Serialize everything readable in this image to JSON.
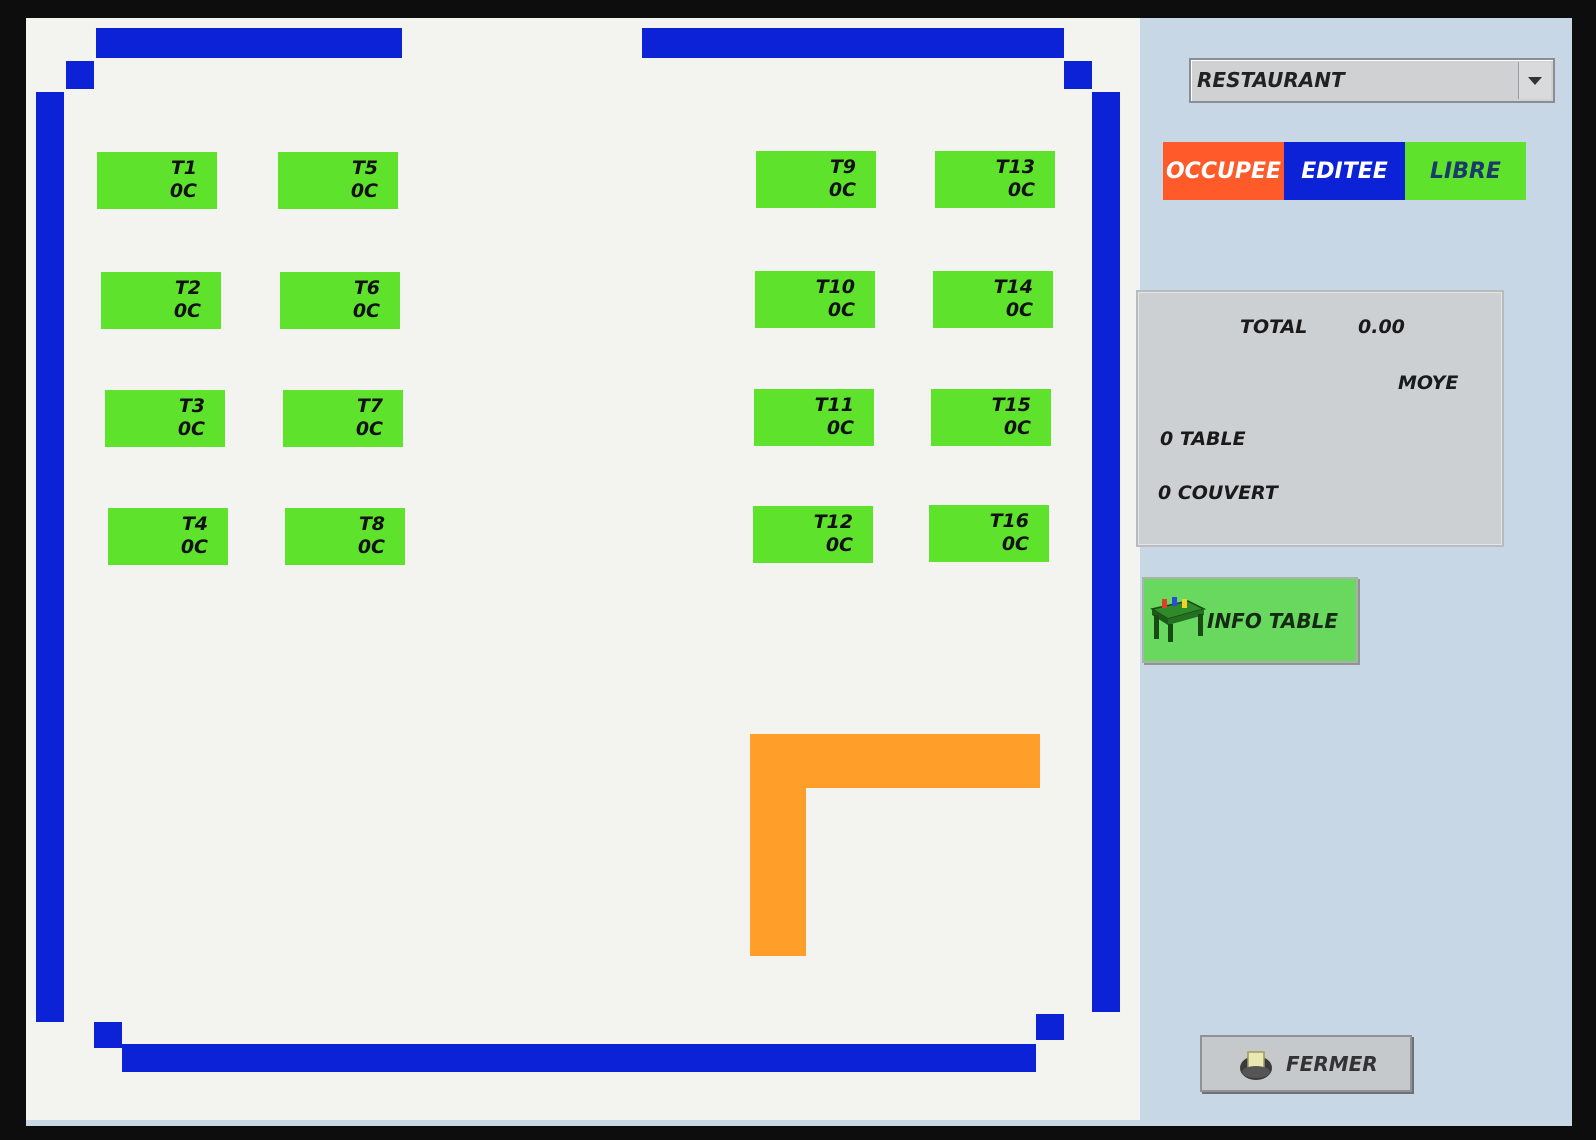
{
  "room_selector": {
    "value": "RESTAURANT",
    "arrow_icon": "chevron-down-icon"
  },
  "legend": [
    {
      "label": "OCCUPEE",
      "bg": "#ff5a2a",
      "fg": "#ffffff"
    },
    {
      "label": "EDITEE",
      "bg": "#0b22d6",
      "fg": "#ffffff"
    },
    {
      "label": "LIBRE",
      "bg": "#5ee22c",
      "fg": "#1a3a6a"
    }
  ],
  "tables": [
    {
      "name": "T1",
      "status": "0C"
    },
    {
      "name": "T2",
      "status": "0C"
    },
    {
      "name": "T3",
      "status": "0C"
    },
    {
      "name": "T4",
      "status": "0C"
    },
    {
      "name": "T5",
      "status": "0C"
    },
    {
      "name": "T6",
      "status": "0C"
    },
    {
      "name": "T7",
      "status": "0C"
    },
    {
      "name": "T8",
      "status": "0C"
    },
    {
      "name": "T9",
      "status": "0C"
    },
    {
      "name": "T10",
      "status": "0C"
    },
    {
      "name": "T11",
      "status": "0C"
    },
    {
      "name": "T12",
      "status": "0C"
    },
    {
      "name": "T13",
      "status": "0C"
    },
    {
      "name": "T14",
      "status": "0C"
    },
    {
      "name": "T15",
      "status": "0C"
    },
    {
      "name": "T16",
      "status": "0C"
    }
  ],
  "stats": {
    "total_label": "TOTAL",
    "total_value": "0.00",
    "average_label": "MOYE",
    "tables": "0 TABLE",
    "covers": "0 COUVERT"
  },
  "info_button": {
    "label": "INFO TABLE",
    "icon": "table-icon"
  },
  "close_button": {
    "label": "FERMER",
    "icon": "exit-icon"
  },
  "colors": {
    "free": "#5ee22c",
    "wall": "#0b22d6",
    "counter": "#ff9f2a",
    "panel": "#c7d7e6"
  }
}
